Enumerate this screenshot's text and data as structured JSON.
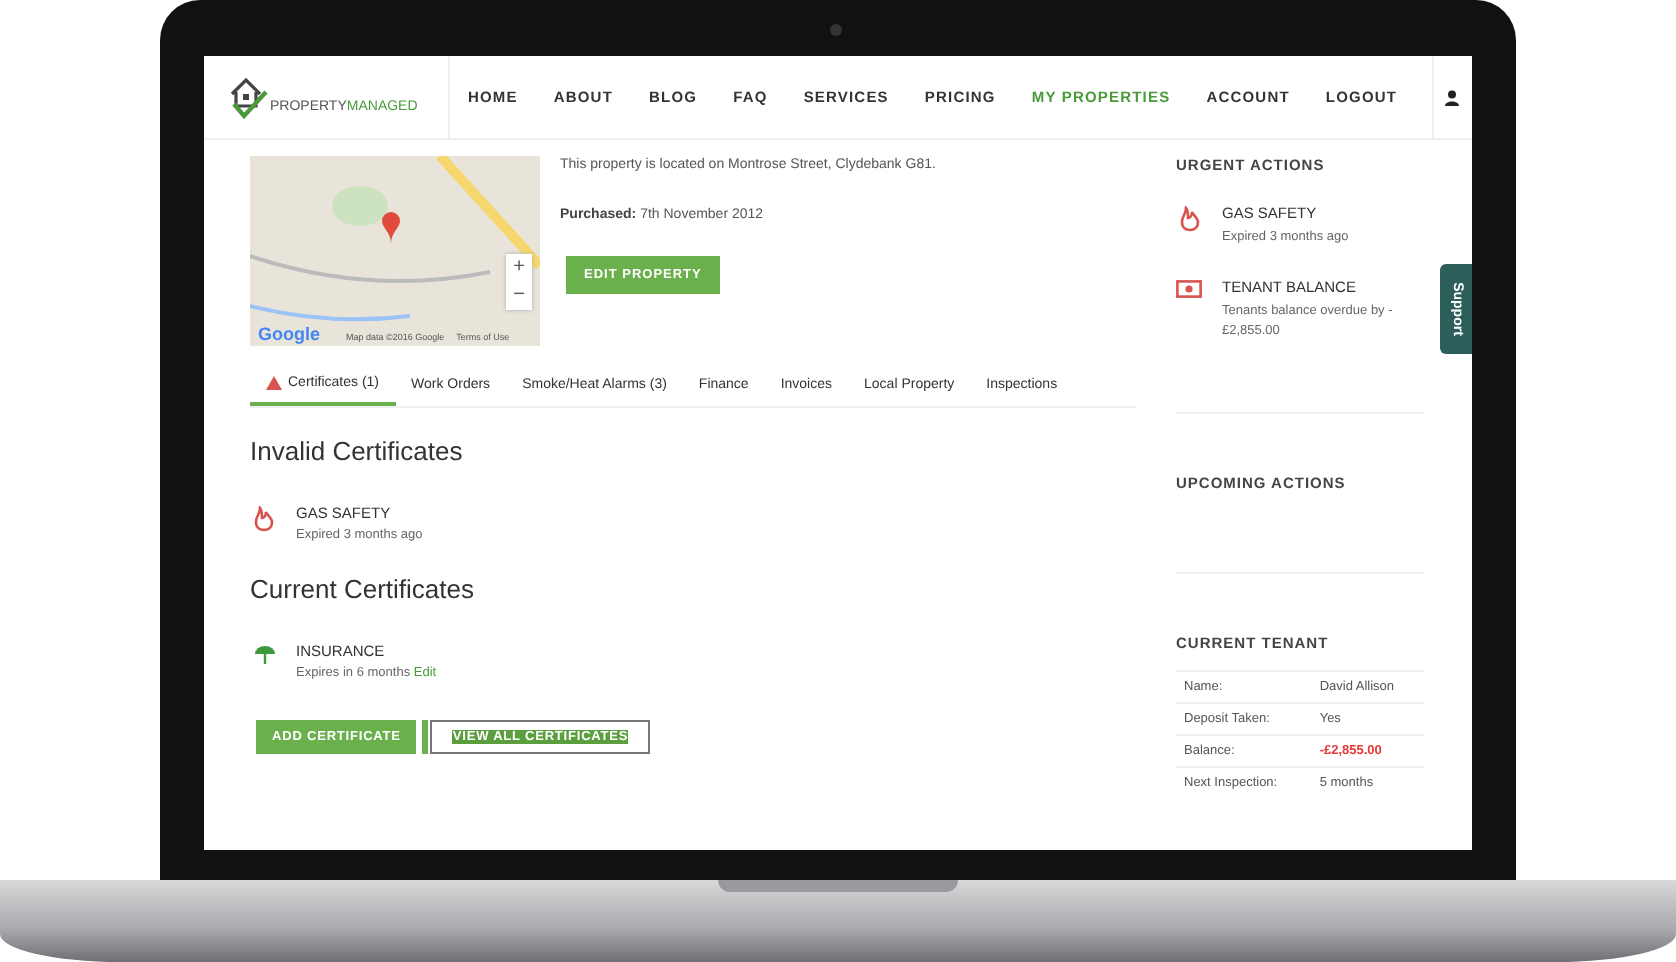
{
  "nav": {
    "logo": {
      "first": "PROPERTY",
      "second": "MANAGED"
    },
    "items": [
      {
        "label": "HOME",
        "selected": false
      },
      {
        "label": "ABOUT",
        "selected": false
      },
      {
        "label": "BLOG",
        "selected": false
      },
      {
        "label": "FAQ",
        "selected": false
      },
      {
        "label": "SERVICES",
        "selected": false
      },
      {
        "label": "PRICING",
        "selected": false
      },
      {
        "label": "MY PROPERTIES",
        "selected": true
      },
      {
        "label": "ACCOUNT",
        "selected": false
      },
      {
        "label": "LOGOUT",
        "selected": false
      }
    ]
  },
  "property": {
    "map": {
      "zoom_in": "+",
      "zoom_out": "−",
      "logo": "Google",
      "attribution": "Map data ©2016 Google",
      "terms": "Terms of Use"
    },
    "location": "This property is located on Montrose Street, Clydebank G81.",
    "purchased_label": "Purchased:",
    "purchased_value": "7th November 2012",
    "edit_button": "EDIT PROPERTY"
  },
  "tabs": [
    {
      "label": "Certificates (1)",
      "selected": true,
      "warning": true
    },
    {
      "label": "Work Orders",
      "selected": false,
      "warning": false
    },
    {
      "label": "Smoke/Heat Alarms (3)",
      "selected": false,
      "warning": false
    },
    {
      "label": "Finance",
      "selected": false,
      "warning": false
    },
    {
      "label": "Invoices",
      "selected": false,
      "warning": false
    },
    {
      "label": "Local Property",
      "selected": false,
      "warning": false
    },
    {
      "label": "Inspections",
      "selected": false,
      "warning": false
    }
  ],
  "sections": [
    {
      "heading": "Invalid Certificates",
      "items": [
        {
          "kind": "gas",
          "title": "GAS SAFETY",
          "detail": "Expired 3 months ago"
        }
      ]
    },
    {
      "heading": "Current Certificates",
      "items": [
        {
          "kind": "insurance",
          "title": "INSURANCE",
          "detail": "Expires in 6 months",
          "link": "Edit"
        }
      ]
    }
  ],
  "buttons": [
    {
      "label": "ADD CERTIFICATE",
      "kind": "primary"
    },
    {
      "label": "VIEW ALL CERTIFICATES",
      "kind": "outline"
    }
  ],
  "sidebar": {
    "urgent": {
      "heading": "URGENT ACTIONS",
      "items": [
        {
          "kind": "gas",
          "title": "GAS SAFETY",
          "detail": "Expired 3 months ago"
        },
        {
          "kind": "money",
          "title": "TENANT BALANCE",
          "detail": "Tenants balance overdue by -£2,855.00"
        }
      ]
    },
    "upcoming": {
      "heading": "UPCOMING ACTIONS"
    },
    "tenant": {
      "heading": "CURRENT TENANT",
      "rows": [
        {
          "label": "Name:",
          "value": "David Allison",
          "alert": false
        },
        {
          "label": "Deposit Taken:",
          "value": "Yes",
          "alert": false
        },
        {
          "label": "Balance:",
          "value": "-£2,855.00",
          "alert": true
        },
        {
          "label": "Next Inspection:",
          "value": "5 months",
          "alert": false
        }
      ]
    }
  },
  "support_tab": "Support"
}
